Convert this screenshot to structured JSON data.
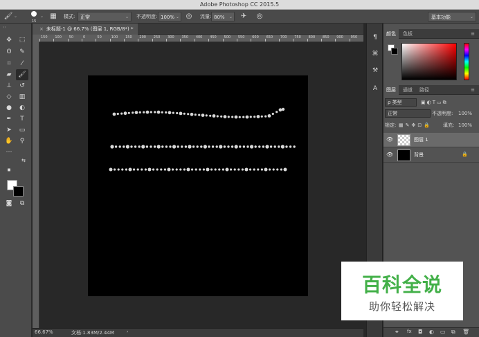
{
  "window": {
    "title": "Adobe Photoshop CC 2015.5"
  },
  "options_bar": {
    "brush_size": "15",
    "mode_label": "模式:",
    "mode_value": "正常",
    "opacity_label": "不透明度:",
    "opacity_value": "100%",
    "flow_label": "流量:",
    "flow_value": "80%",
    "workspace": "基本功能"
  },
  "document": {
    "tab_title": "未标题-1 @ 66.7% (图层 1, RGB/8*) *",
    "tab_close": "×",
    "ruler_labels": [
      "150",
      "100",
      "50",
      "0",
      "50",
      "100",
      "150",
      "200",
      "250",
      "300",
      "350",
      "400",
      "450",
      "500",
      "550",
      "600",
      "650",
      "700",
      "750",
      "800",
      "850",
      "900",
      "950"
    ],
    "zoom": "66.67%",
    "doc_info": "文档:1.83M/2.44M",
    "canvas_color": "#000000",
    "dot_color": "#d8d8d8"
  },
  "colors": {
    "foreground": "#ffffff",
    "background": "#000000"
  },
  "panels": {
    "color_tabs": [
      "颜色",
      "色板"
    ],
    "layer_tabs": [
      "图层",
      "通道",
      "路径"
    ],
    "filter_kind": "ρ 类型",
    "blend_mode": "正常",
    "opacity_label": "不透明度:",
    "opacity_value": "100%",
    "lock_label": "锁定:",
    "fill_label": "填充:",
    "fill_value": "100%",
    "layers": [
      {
        "name": "图层 1",
        "thumb": "transparent",
        "selected": true
      },
      {
        "name": "背景",
        "thumb": "black",
        "selected": false,
        "locked": true
      }
    ],
    "footer_icons": [
      "link-icon",
      "fx-icon",
      "mask-icon",
      "adjustment-icon",
      "group-icon",
      "new-layer-icon",
      "trash-icon"
    ]
  },
  "watermark": {
    "title": "百科全说",
    "subtitle": "助你轻松解决"
  }
}
